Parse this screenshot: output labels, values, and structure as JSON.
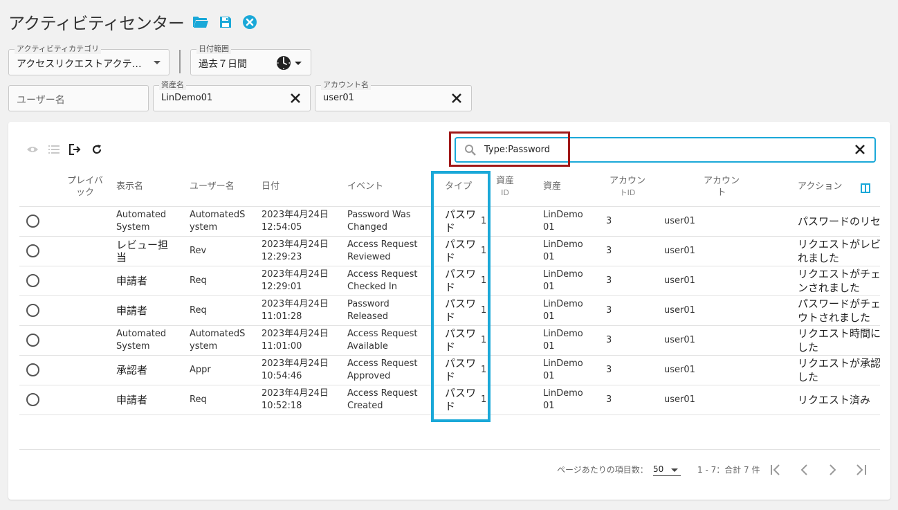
{
  "header": {
    "title": "アクティビティセンター"
  },
  "filters": {
    "category": {
      "label": "アクティビティカテゴリ",
      "value": "アクセスリクエストアクテ…"
    },
    "date_range": {
      "label": "日付範囲",
      "value": "過去７日間"
    },
    "username": {
      "placeholder": "ユーザー名"
    },
    "asset_name": {
      "label": "資産名",
      "value": "LinDemo01"
    },
    "account_name": {
      "label": "アカウント名",
      "value": "user01"
    }
  },
  "search": {
    "value": "Type:Password"
  },
  "columns": {
    "playback": "プレイバック",
    "display_name": "表示名",
    "user_name": "ユーザー名",
    "date": "日付",
    "event": "イベント",
    "type": "タイプ",
    "asset_id_a": "資産",
    "asset_id_b": "ID",
    "asset": "資産",
    "account_id_a": "アカウン",
    "account_id_b": "トID",
    "account_a": "アカウン",
    "account_b": "ト",
    "action": "アクション"
  },
  "rows": [
    {
      "display_name": "Automated System",
      "user_name": "AutomatedSystem",
      "date": "2023年4月24日",
      "time": "12:54:05",
      "event": "Password Was Changed",
      "type": "パスワード",
      "asset_id": "1",
      "asset": "LinDemo01",
      "account_id": "3",
      "account": "user01",
      "action": "パスワードのリセット"
    },
    {
      "display_name": "レビュー担当",
      "user_name": "Rev",
      "date": "2023年4月24日",
      "time": "12:29:23",
      "event": "Access Request Reviewed",
      "type": "パスワード",
      "asset_id": "1",
      "asset": "LinDemo01",
      "account_id": "3",
      "account": "user01",
      "action": "リクエストがレビューされました"
    },
    {
      "display_name": "申請者",
      "user_name": "Req",
      "date": "2023年4月24日",
      "time": "12:29:01",
      "event": "Access Request Checked In",
      "type": "パスワード",
      "asset_id": "1",
      "asset": "LinDemo01",
      "account_id": "3",
      "account": "user01",
      "action": "リクエストがチェックインされました"
    },
    {
      "display_name": "申請者",
      "user_name": "Req",
      "date": "2023年4月24日",
      "time": "11:01:28",
      "event": "Password Released",
      "type": "パスワード",
      "asset_id": "1",
      "asset": "LinDemo01",
      "account_id": "3",
      "account": "user01",
      "action": "パスワードがチェックアウトされました"
    },
    {
      "display_name": "Automated System",
      "user_name": "AutomatedSystem",
      "date": "2023年4月24日",
      "time": "11:01:00",
      "event": "Access Request Available",
      "type": "パスワード",
      "asset_id": "1",
      "asset": "LinDemo01",
      "account_id": "3",
      "account": "user01",
      "action": "リクエスト時間に達しました"
    },
    {
      "display_name": "承認者",
      "user_name": "Appr",
      "date": "2023年4月24日",
      "time": "10:54:46",
      "event": "Access Request Approved",
      "type": "パスワード",
      "asset_id": "1",
      "asset": "LinDemo01",
      "account_id": "3",
      "account": "user01",
      "action": "リクエストが承認されました"
    },
    {
      "display_name": "申請者",
      "user_name": "Req",
      "date": "2023年4月24日",
      "time": "10:52:18",
      "event": "Access Request Created",
      "type": "パスワード",
      "asset_id": "1",
      "asset": "LinDemo01",
      "account_id": "3",
      "account": "user01",
      "action": "リクエスト済み"
    }
  ],
  "pagination": {
    "per_page_label": "ページあたりの項目数：",
    "per_page_value": "50",
    "range": "1 - 7：合計 7 件"
  },
  "colors": {
    "accent": "#1aa8d8",
    "highlight_red": "#a01818"
  }
}
